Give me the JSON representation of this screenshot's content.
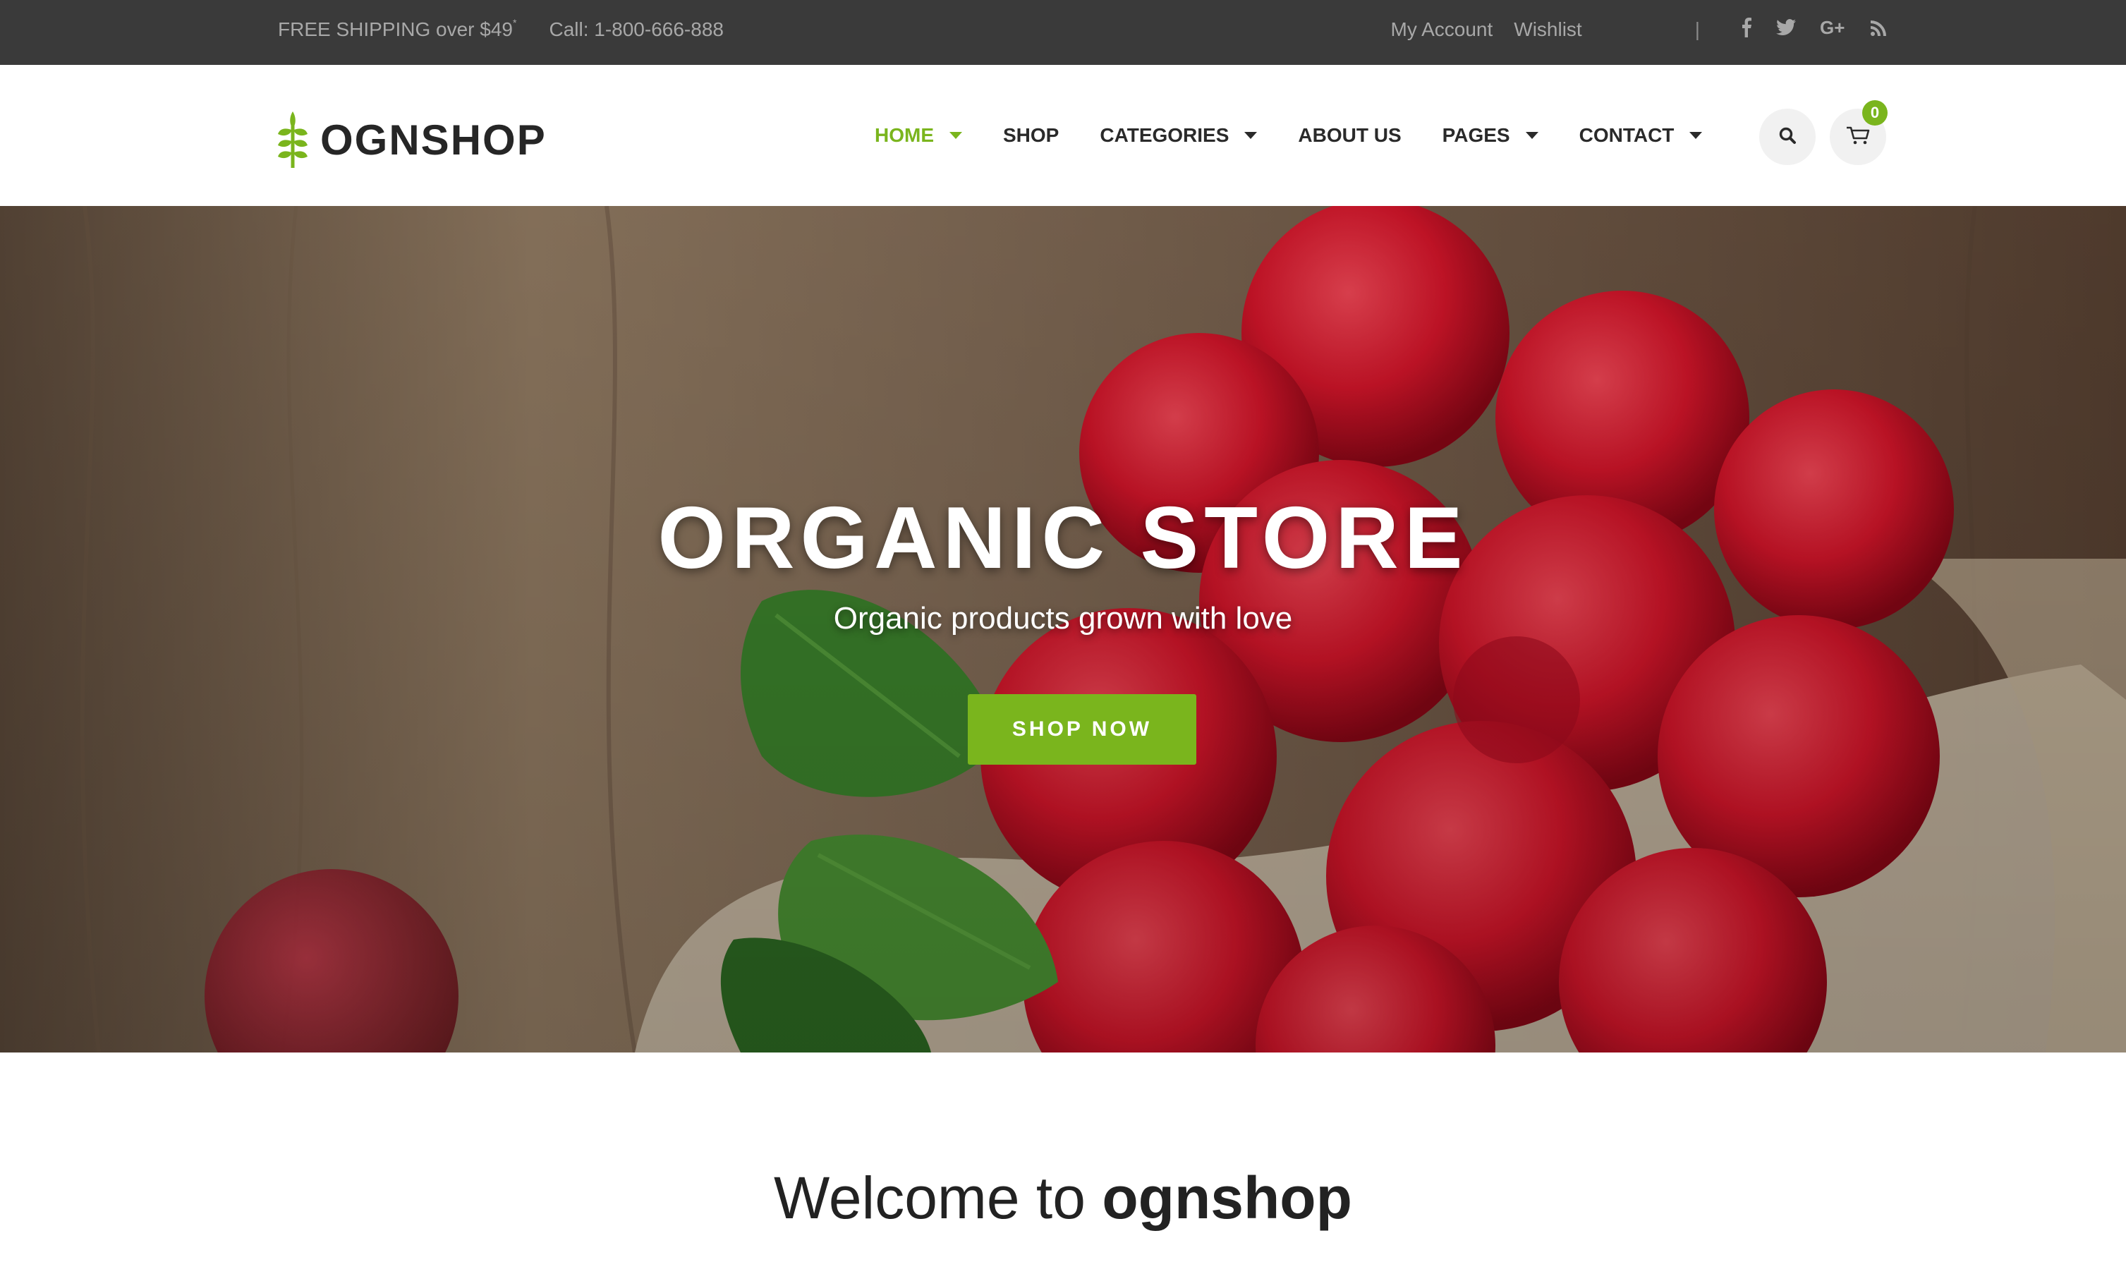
{
  "topbar": {
    "shipping": "FREE SHIPPING over $49",
    "shipping_mark": "*",
    "phone": "Call: 1-800-666-888",
    "my_account": "My Account",
    "wishlist": "Wishlist",
    "separator": "|",
    "social": [
      {
        "icon": "facebook-icon",
        "glyph": "f"
      },
      {
        "icon": "twitter-icon",
        "glyph": "t"
      },
      {
        "icon": "google-plus-icon",
        "glyph": "G+"
      },
      {
        "icon": "rss-icon",
        "glyph": "rss"
      }
    ]
  },
  "header": {
    "logo_text": "OGNSHOP",
    "nav": [
      {
        "label": "HOME",
        "active": true,
        "dropdown": true
      },
      {
        "label": "SHOP",
        "active": false,
        "dropdown": false
      },
      {
        "label": "CATEGORIES",
        "active": false,
        "dropdown": true
      },
      {
        "label": "ABOUT US",
        "active": false,
        "dropdown": false
      },
      {
        "label": "PAGES",
        "active": false,
        "dropdown": true
      },
      {
        "label": "CONTACT",
        "active": false,
        "dropdown": true
      }
    ],
    "cart_count": "0",
    "search_icon": "search-icon",
    "cart_icon": "cart-icon"
  },
  "hero": {
    "title": "ORGANIC STORE",
    "subtitle": "Organic products grown with love",
    "cta": "SHOP NOW"
  },
  "welcome": {
    "prefix": "Welcome to",
    "brand": "ognshop"
  },
  "colors": {
    "accent": "#7ab51d",
    "topbar_bg": "#3a3a3a",
    "topbar_text": "#a8a8a8",
    "nav_text": "#2a2a2a"
  }
}
